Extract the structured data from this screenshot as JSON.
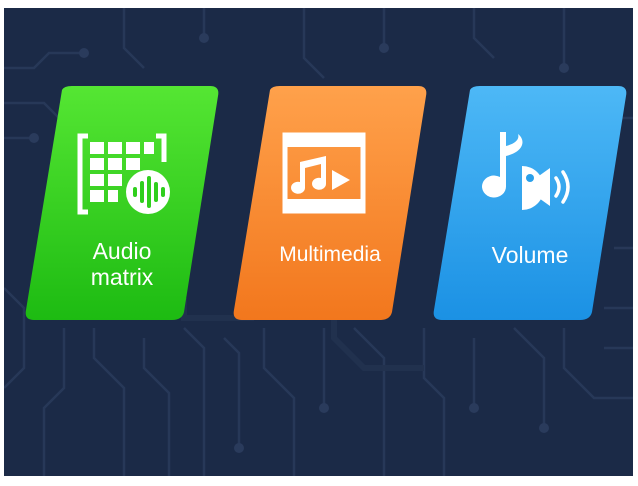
{
  "tiles": [
    {
      "id": "audio-matrix",
      "label": "Audio\nmatrix",
      "icon": "audio-matrix-icon",
      "color_top": "#4fe32f",
      "color_bottom": "#1fbf14"
    },
    {
      "id": "multimedia",
      "label": "Multimedia",
      "icon": "multimedia-icon",
      "color_top": "#ffa04a",
      "color_bottom": "#f47820"
    },
    {
      "id": "volume",
      "label": "Volume",
      "icon": "volume-icon",
      "color_top": "#4ab6f5",
      "color_bottom": "#1e93e6"
    }
  ],
  "background_color": "#1b2a47"
}
